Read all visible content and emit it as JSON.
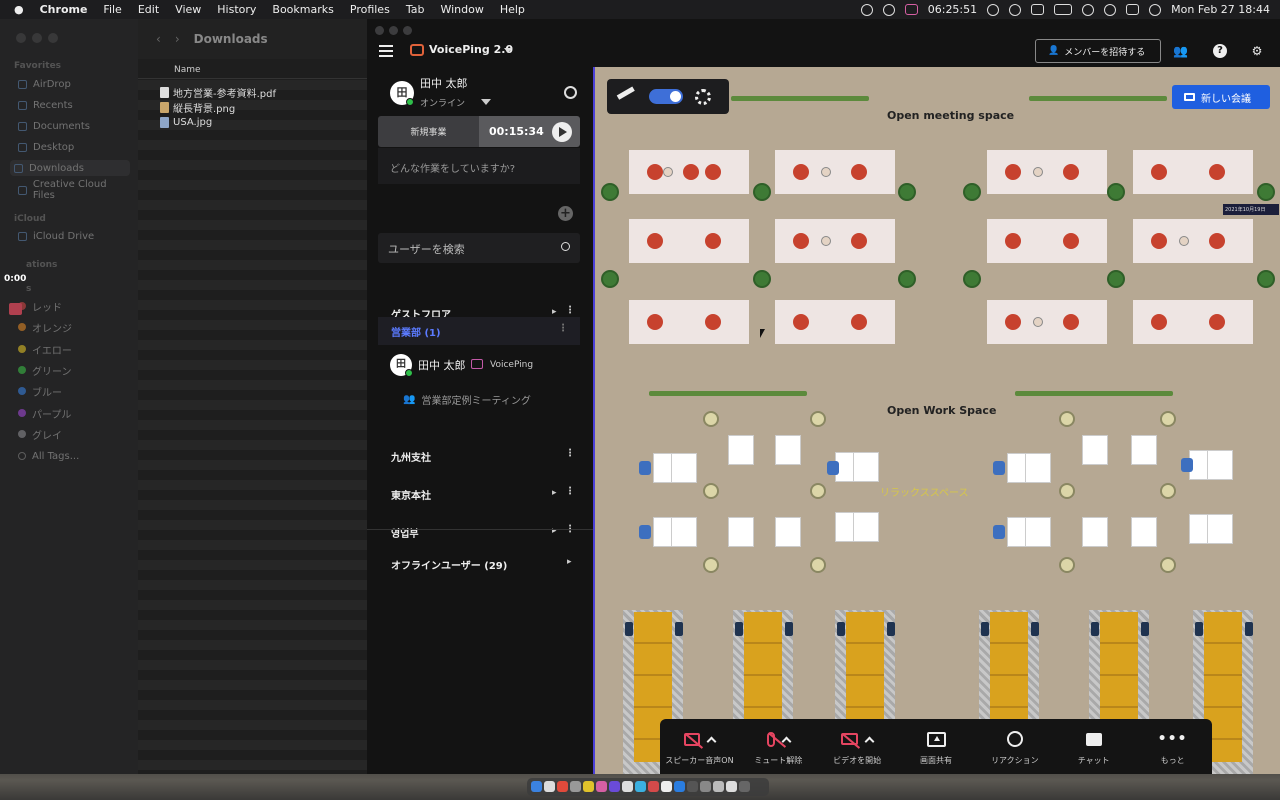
{
  "menubar": {
    "app": "Chrome",
    "items": [
      "File",
      "Edit",
      "View",
      "History",
      "Bookmarks",
      "Profiles",
      "Tab",
      "Window",
      "Help"
    ],
    "timer": "06:25:51",
    "datetime": "Mon Feb 27  18:44"
  },
  "finder": {
    "title": "Downloads",
    "column_header": "Name",
    "favorites_header": "Favorites",
    "favorites": [
      "AirDrop",
      "Recents",
      "Documents",
      "Desktop",
      "Downloads",
      "Creative Cloud Files"
    ],
    "icloud_header": "iCloud",
    "icloud": [
      "iCloud Drive"
    ],
    "locations_header": "ations",
    "tags_header": "s",
    "tags": [
      {
        "label": "レッド",
        "color": "#d44a4a"
      },
      {
        "label": "オレンジ",
        "color": "#e08a2b"
      },
      {
        "label": "イエロー",
        "color": "#e0c22b"
      },
      {
        "label": "グリーン",
        "color": "#3fbf4a"
      },
      {
        "label": "ブルー",
        "color": "#3b82e0"
      },
      {
        "label": "パープル",
        "color": "#a24bd8"
      },
      {
        "label": "グレイ",
        "color": "#8e8e93"
      }
    ],
    "all_tags": "All Tags...",
    "files": [
      "地方営業-参考資料.pdf",
      "縦長背景.png",
      "USA.jpg"
    ],
    "overlay_timer": "0:00"
  },
  "app": {
    "brand": "VoicePing 2.0",
    "invite_label": "メンバーを招待する",
    "user": {
      "name": "田中 太郎",
      "status": "オンライン",
      "avatar": "田"
    },
    "task": {
      "name": "新規事業",
      "time": "00:15:34"
    },
    "doing_placeholder": "どんな作業をしていますか?",
    "search_placeholder": "ユーザーを検索",
    "groups": {
      "guest": "ゲストフロア",
      "sales": "営業部 (1)",
      "kyushu": "九州支社",
      "tokyo": "東京本社",
      "korean": "영업부",
      "offline": "オフラインユーザー (29)"
    },
    "member": {
      "name": "田中 太郎",
      "app": "VoicePing",
      "avatar": "田"
    },
    "room": "営業部定例ミーティング",
    "accent": "#1f5fe0"
  },
  "map": {
    "new_meeting": "新しい会議",
    "meeting_area": "Open  meeting space",
    "work_area": "Open  Work Space",
    "relax": "リラックススペース",
    "signal": "2021年10月19日"
  },
  "controls": [
    {
      "label": "スピーカー音声ON",
      "icon": "speaker-muted-icon"
    },
    {
      "label": "ミュート解除",
      "icon": "mic-muted-icon"
    },
    {
      "label": "ビデオを開始",
      "icon": "video-off-icon"
    },
    {
      "label": "画面共有",
      "icon": "screen-share-icon"
    },
    {
      "label": "リアクション",
      "icon": "reaction-icon"
    },
    {
      "label": "チャット",
      "icon": "chat-icon"
    },
    {
      "label": "もっと",
      "icon": "more-icon"
    }
  ]
}
